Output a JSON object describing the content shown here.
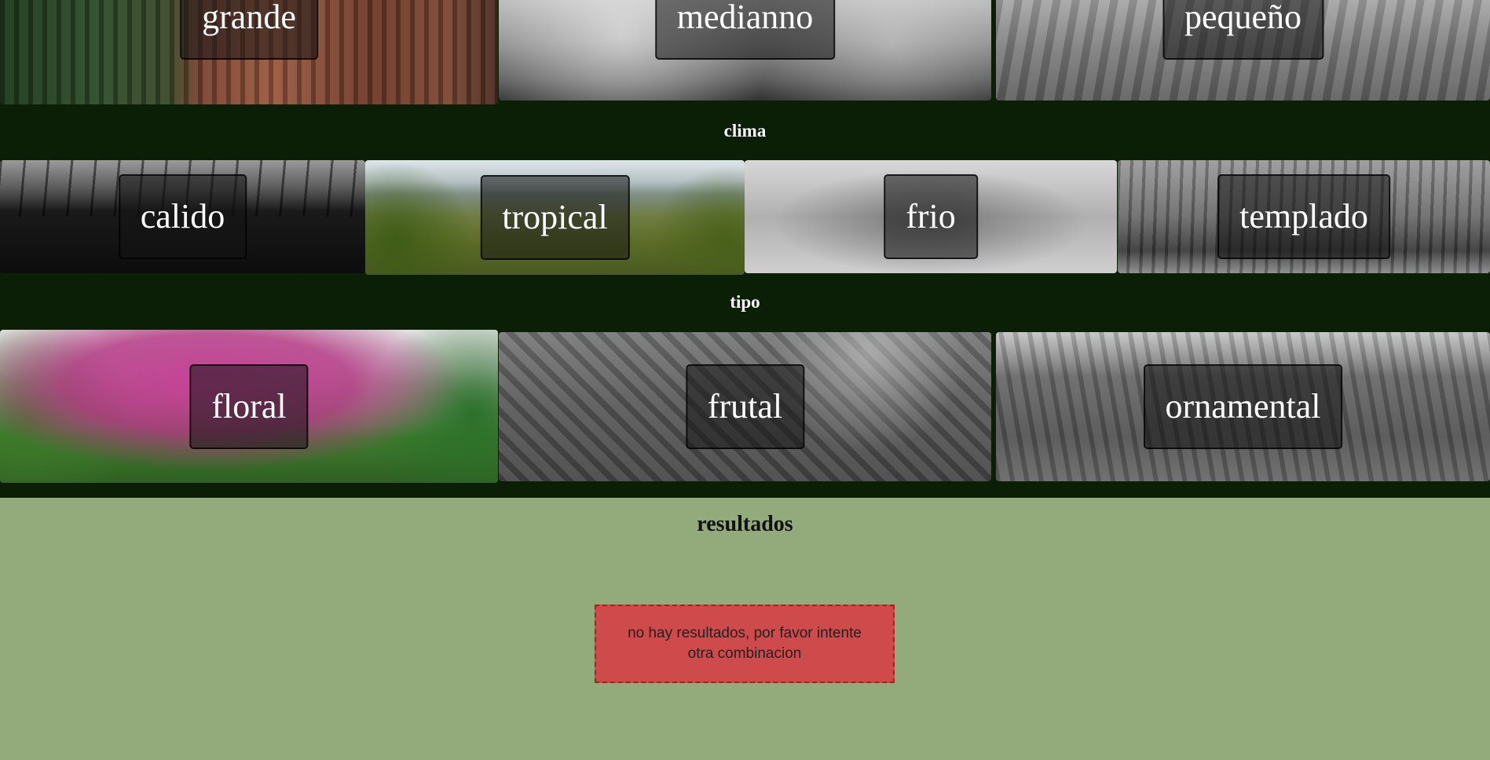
{
  "size": {
    "section_label": "",
    "options": [
      {
        "label": "grande"
      },
      {
        "label": "medianno"
      },
      {
        "label": "pequeño"
      }
    ]
  },
  "clima": {
    "section_label": "clima",
    "options": [
      {
        "label": "calido"
      },
      {
        "label": "tropical"
      },
      {
        "label": "frio"
      },
      {
        "label": "templado"
      }
    ]
  },
  "tipo": {
    "section_label": "tipo",
    "options": [
      {
        "label": "floral"
      },
      {
        "label": "frutal"
      },
      {
        "label": "ornamental"
      }
    ]
  },
  "results": {
    "title": "resultados",
    "empty_message": "no hay resultados, por favor intente otra combinacion"
  },
  "colors": {
    "page_background": "#0b1f06",
    "results_background": "#93ab7b",
    "alert_background": "#cf4a4a",
    "alert_border": "#a81e1e"
  }
}
